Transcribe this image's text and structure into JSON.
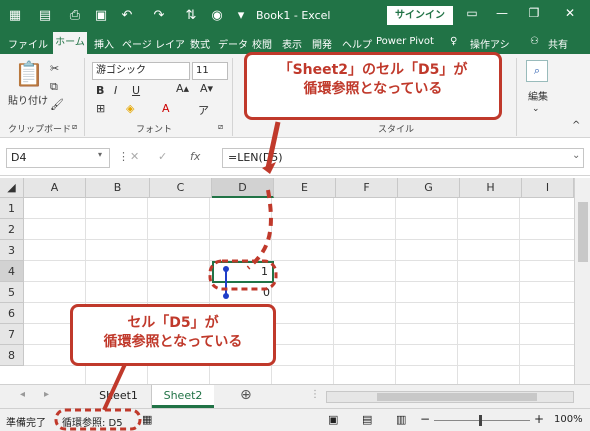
{
  "titlebar": {
    "title": "Book1  -  Excel",
    "signin": "サインイン",
    "minimize": "—",
    "restore": "❐",
    "close": "✕"
  },
  "tabs": {
    "file": "ファイル",
    "home": "ホーム",
    "insert": "挿入",
    "page_layout": "ページ レイアウト",
    "formulas": "数式",
    "data": "データ",
    "review": "校閲",
    "view": "表示",
    "developer": "開発",
    "help": "ヘルプ",
    "power_pivot": "Power Pivot",
    "tell_me": "操作アシ",
    "share": "共有"
  },
  "ribbon": {
    "paste": "貼り付け",
    "clipboard": "クリップボード",
    "font_name": "游ゴシック",
    "font_size": "11",
    "font": "フォント",
    "style": "スタイル",
    "editing": "編集",
    "bold": "B",
    "italic": "I",
    "underline": "U"
  },
  "formula": {
    "namebox": "D4",
    "fx": "fx",
    "content": "=LEN(D5)"
  },
  "columns": [
    "A",
    "B",
    "C",
    "D",
    "E",
    "F",
    "G",
    "H",
    "I"
  ],
  "rows": [
    "1",
    "2",
    "3",
    "4",
    "5",
    "6",
    "7",
    "8"
  ],
  "cells": {
    "d4": "1",
    "d5": "0"
  },
  "sheets": {
    "sheet1": "Sheet1",
    "sheet2": "Sheet2"
  },
  "status": {
    "ready": "準備完了",
    "circ": "循環参照: D5",
    "zoom": "100%"
  },
  "callouts": {
    "top": "「Sheet2」のセル「D5」が\n循環参照となっている",
    "bottom": "セル「D5」が\n循環参照となっている"
  },
  "colors": {
    "excel_green": "#217346",
    "callout_red": "#c0392b"
  }
}
